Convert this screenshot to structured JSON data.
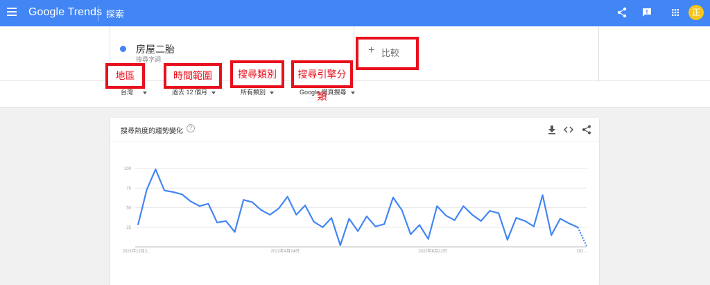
{
  "appbar": {
    "logo_google": "Google",
    "logo_trends": "Trends",
    "title": "探索",
    "avatar_text": "正"
  },
  "term": {
    "name": "房屋二胎",
    "type": "搜尋字詞",
    "color": "#4285f4"
  },
  "compare": {
    "plus": "+",
    "label": "比較"
  },
  "filters": {
    "region": "台灣",
    "time": "過去 12 個月",
    "category": "所有類別",
    "property": "Google 網頁搜尋"
  },
  "annotations": {
    "region": "地區",
    "time": "時間範圍",
    "category": "搜尋類別",
    "property": "搜尋引擎分類",
    "color": "#e8101d"
  },
  "card": {
    "title": "搜尋熱度的趨勢變化",
    "help": "?"
  },
  "chart_data": {
    "type": "line",
    "ylim": [
      0,
      100
    ],
    "yticks": [
      "100",
      "75",
      "50",
      "25"
    ],
    "xticks": [
      "2021年12月2...",
      "2022年4月24日",
      "2022年8月21日",
      "202..."
    ],
    "grid": true,
    "color": "#4285f4",
    "values": [
      28,
      73,
      99,
      72,
      70,
      67,
      58,
      52,
      55,
      31,
      33,
      19,
      60,
      57,
      47,
      41,
      49,
      64,
      41,
      53,
      32,
      25,
      37,
      2,
      36,
      20,
      39,
      26,
      29,
      63,
      47,
      16,
      28,
      10,
      52,
      40,
      34,
      52,
      41,
      33,
      46,
      43,
      9,
      37,
      33,
      26,
      66,
      15,
      36,
      30,
      25,
      1
    ]
  }
}
